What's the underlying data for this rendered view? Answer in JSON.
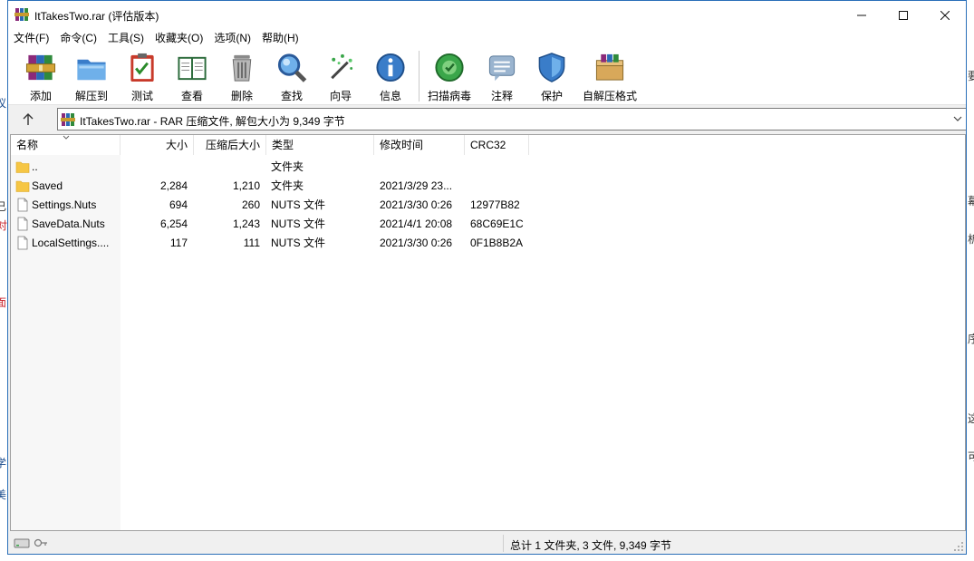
{
  "window": {
    "title": "ItTakesTwo.rar (评估版本)"
  },
  "menu": [
    "文件(F)",
    "命令(C)",
    "工具(S)",
    "收藏夹(O)",
    "选项(N)",
    "帮助(H)"
  ],
  "toolbar": [
    {
      "label": "添加",
      "icon": "add-archive-icon"
    },
    {
      "label": "解压到",
      "icon": "extract-to-folder-icon"
    },
    {
      "label": "测试",
      "icon": "test-clipboard-icon"
    },
    {
      "label": "查看",
      "icon": "view-book-icon"
    },
    {
      "label": "删除",
      "icon": "trash-can-icon"
    },
    {
      "label": "查找",
      "icon": "magnifier-icon"
    },
    {
      "label": "向导",
      "icon": "wizard-wand-icon"
    },
    {
      "label": "信息",
      "icon": "info-icon"
    },
    {
      "label": "扫描病毒",
      "icon": "virus-scan-icon"
    },
    {
      "label": "注释",
      "icon": "comment-icon"
    },
    {
      "label": "保护",
      "icon": "shield-icon"
    },
    {
      "label": "自解压格式",
      "icon": "sfx-box-icon"
    }
  ],
  "address": {
    "path": "ItTakesTwo.rar - RAR 压缩文件, 解包大小为 9,349 字节"
  },
  "columns": [
    "名称",
    "大小",
    "压缩后大小",
    "类型",
    "修改时间",
    "CRC32"
  ],
  "files": [
    {
      "name": "..",
      "size": "",
      "packed": "",
      "type": "文件夹",
      "modified": "",
      "crc": "",
      "kind": "folder"
    },
    {
      "name": "Saved",
      "size": "2,284",
      "packed": "1,210",
      "type": "文件夹",
      "modified": "2021/3/29 23...",
      "crc": "",
      "kind": "folder"
    },
    {
      "name": "Settings.Nuts",
      "size": "694",
      "packed": "260",
      "type": "NUTS 文件",
      "modified": "2021/3/30 0:26",
      "crc": "12977B82",
      "kind": "file"
    },
    {
      "name": "SaveData.Nuts",
      "size": "6,254",
      "packed": "1,243",
      "type": "NUTS 文件",
      "modified": "2021/4/1 20:08",
      "crc": "68C69E1C",
      "kind": "file"
    },
    {
      "name": "LocalSettings....",
      "size": "117",
      "packed": "111",
      "type": "NUTS 文件",
      "modified": "2021/3/30 0:26",
      "crc": "0F1B8B2A",
      "kind": "file"
    }
  ],
  "status": {
    "summary": "总计 1 文件夹, 3 文件, 9,349 字节"
  },
  "colors": {
    "window_border": "#2a6fb8",
    "folder": "#f6c644",
    "list_bg": "#ffffff"
  }
}
